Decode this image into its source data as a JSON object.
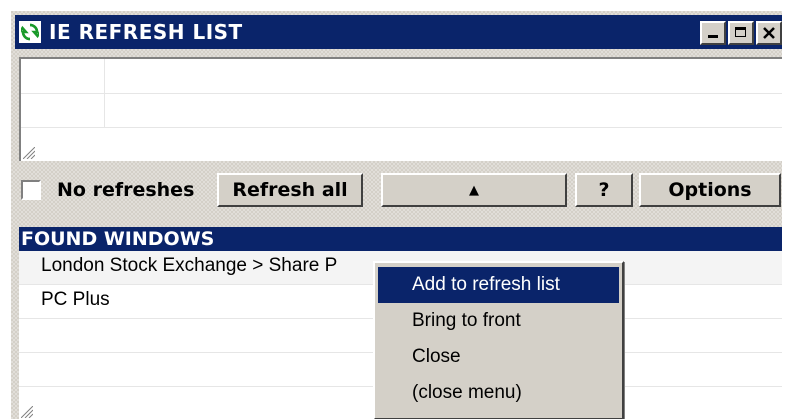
{
  "window": {
    "title": "IE REFRESH LIST",
    "titlebar_color": "#0a246a",
    "face_color": "#d4d0c8"
  },
  "toolbar": {
    "no_refreshes_label": "No refreshes",
    "no_refreshes_checked": false,
    "refresh_all_label": "Refresh all",
    "up_label": "▲",
    "help_label": "?",
    "options_label": "Options"
  },
  "found_windows": {
    "header": "FOUND WINDOWS",
    "items": [
      "London Stock Exchange > Share P",
      "PC Plus"
    ]
  },
  "context_menu": {
    "items": [
      "Add to refresh list",
      "Bring to front",
      "Close",
      "(close menu)"
    ],
    "selected": "Add to refresh list"
  },
  "icons": {
    "app": "refresh-icon",
    "minimize": "minimize-icon",
    "maximize": "maximize-icon",
    "close": "close-icon",
    "grip": "resize-grip-icon"
  }
}
